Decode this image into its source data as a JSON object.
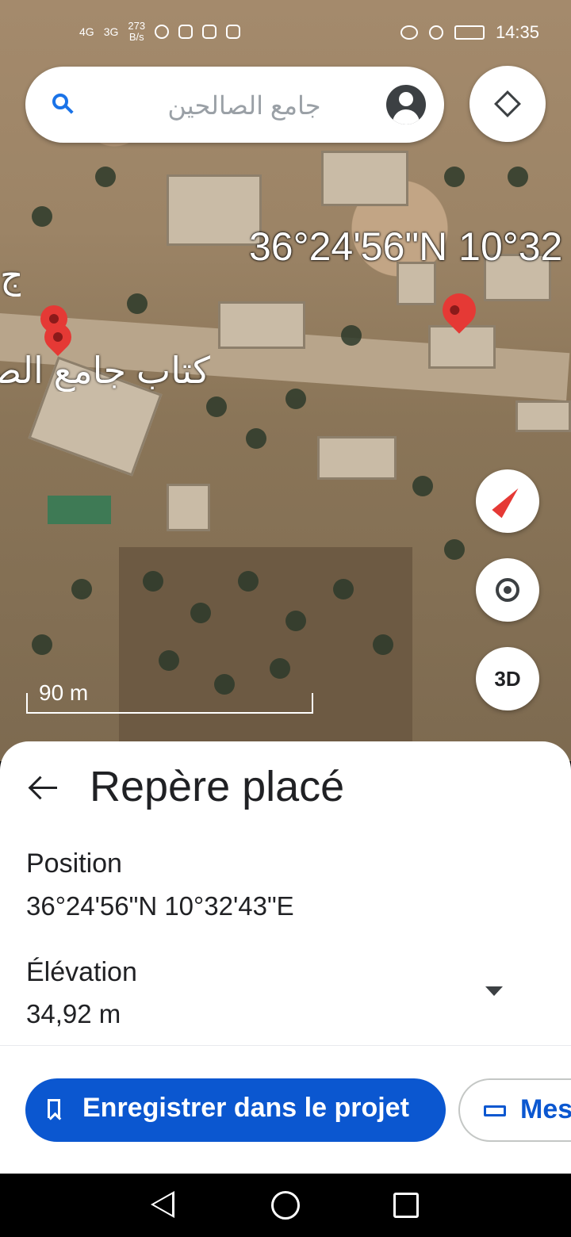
{
  "status_bar": {
    "network_1": "4G",
    "network_2": "3G",
    "speed_value": "273",
    "speed_unit": "B/s",
    "time": "14:35"
  },
  "search": {
    "query": "جامع الصالحين"
  },
  "map": {
    "coordinate_overlay": "36°24'56\"N 10°32",
    "place_label": "كتاب جامع الصالحين",
    "edge_label": "ج",
    "scale_label": "90 m"
  },
  "map_controls": {
    "threed_label": "3D"
  },
  "sheet": {
    "title": "Repère placé",
    "position_label": "Position",
    "position_value": "36°24'56\"N 10°32'43\"E",
    "elevation_label": "Élévation",
    "elevation_value": "34,92 m",
    "save_button_label": "Enregistrer dans le projet",
    "measure_button_label": "Mesurer"
  },
  "colors": {
    "accent": "#0b57d0",
    "pin": "#e53935",
    "search_icon": "#1a73e8"
  }
}
